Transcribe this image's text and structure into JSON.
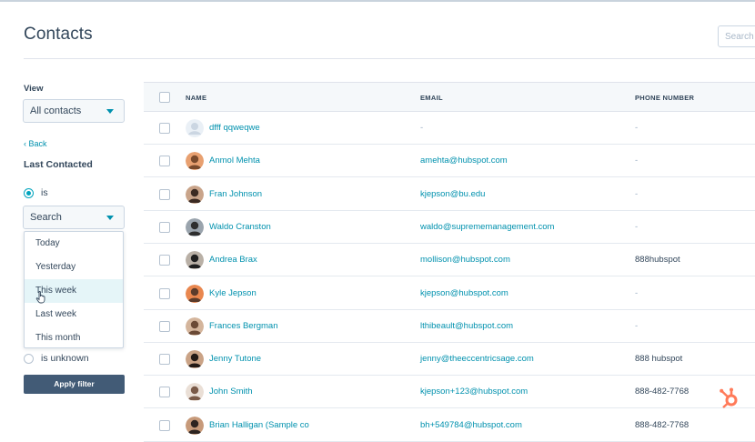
{
  "header": {
    "title": "Contacts",
    "search_placeholder": "Search"
  },
  "sidebar": {
    "view_label": "View",
    "view_value": "All contacts",
    "back_label": "‹ Back",
    "filter_title": "Last Contacted",
    "option_is": "is",
    "search_value": "Search",
    "dropdown_options": [
      "Today",
      "Yesterday",
      "This week",
      "Last week",
      "This month"
    ],
    "hovered_option": "This week",
    "option_unknown": "is unknown",
    "apply_label": "Apply filter"
  },
  "table": {
    "columns": {
      "name": "NAME",
      "email": "EMAIL",
      "phone": "PHONE NUMBER"
    },
    "rows": [
      {
        "name": "dfff qqweqwe",
        "email": "-",
        "phone": "-",
        "avatar": "placeholder"
      },
      {
        "name": "Anmol Mehta",
        "email": "amehta@hubspot.com",
        "phone": "-",
        "avatar": "photo"
      },
      {
        "name": "Fran Johnson",
        "email": "kjepson@bu.edu",
        "phone": "-",
        "avatar": "photo"
      },
      {
        "name": "Waldo Cranston",
        "email": "waldo@suprememanagement.com",
        "phone": "-",
        "avatar": "photo"
      },
      {
        "name": "Andrea Brax",
        "email": "mollison@hubspot.com",
        "phone": "888hubspot",
        "avatar": "photo"
      },
      {
        "name": "Kyle Jepson",
        "email": "kjepson@hubspot.com",
        "phone": "-",
        "avatar": "photo"
      },
      {
        "name": "Frances Bergman",
        "email": "lthibeault@hubspot.com",
        "phone": "-",
        "avatar": "photo"
      },
      {
        "name": "Jenny Tutone",
        "email": "jenny@theeccentricsage.com",
        "phone": "888 hubspot",
        "avatar": "photo"
      },
      {
        "name": "John Smith",
        "email": "kjepson+123@hubspot.com",
        "phone": "888-482-7768",
        "avatar": "photo"
      },
      {
        "name": "Brian Halligan (Sample co",
        "email": "bh+549784@hubspot.com",
        "phone": "888-482-7768",
        "avatar": "photo"
      }
    ]
  },
  "colors": {
    "link": "#0091ae",
    "text": "#33475b",
    "button": "#425b76",
    "sprocket": "#ff7a59"
  }
}
